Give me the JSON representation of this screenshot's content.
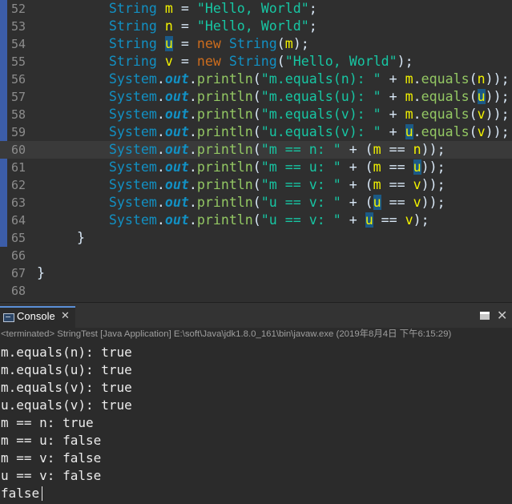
{
  "editor": {
    "current_line": "60",
    "lines": [
      {
        "n": "52",
        "tokens": [
          [
            "         ",
            "p"
          ],
          [
            "String",
            "y"
          ],
          [
            " ",
            "p"
          ],
          [
            "m",
            "v"
          ],
          [
            " = ",
            "p"
          ],
          [
            "\"Hello, World\"",
            "s"
          ],
          [
            ";",
            "p"
          ]
        ]
      },
      {
        "n": "53",
        "tokens": [
          [
            "         ",
            "p"
          ],
          [
            "String",
            "y"
          ],
          [
            " ",
            "p"
          ],
          [
            "n",
            "v"
          ],
          [
            " = ",
            "p"
          ],
          [
            "\"Hello, World\"",
            "s"
          ],
          [
            ";",
            "p"
          ]
        ]
      },
      {
        "n": "54",
        "tokens": [
          [
            "         ",
            "p"
          ],
          [
            "String",
            "y"
          ],
          [
            " ",
            "p"
          ],
          [
            "u",
            "h"
          ],
          [
            " = ",
            "p"
          ],
          [
            "new",
            "k"
          ],
          [
            " ",
            "p"
          ],
          [
            "String",
            "y"
          ],
          [
            "(",
            "p"
          ],
          [
            "m",
            "v"
          ],
          [
            ");",
            "p"
          ]
        ]
      },
      {
        "n": "55",
        "tokens": [
          [
            "         ",
            "p"
          ],
          [
            "String",
            "y"
          ],
          [
            " ",
            "p"
          ],
          [
            "v",
            "v"
          ],
          [
            " = ",
            "p"
          ],
          [
            "new",
            "k"
          ],
          [
            " ",
            "p"
          ],
          [
            "String",
            "y"
          ],
          [
            "(",
            "p"
          ],
          [
            "\"Hello, World\"",
            "s"
          ],
          [
            ");",
            "p"
          ]
        ]
      },
      {
        "n": "56",
        "tokens": [
          [
            "         ",
            "p"
          ],
          [
            "System",
            "y"
          ],
          [
            ".",
            "p"
          ],
          [
            "out",
            "i"
          ],
          [
            ".",
            "p"
          ],
          [
            "println",
            "m"
          ],
          [
            "(",
            "p"
          ],
          [
            "\"m.equals(n): \"",
            "s"
          ],
          [
            " + ",
            "p"
          ],
          [
            "m",
            "v"
          ],
          [
            ".",
            "p"
          ],
          [
            "equals",
            "m"
          ],
          [
            "(",
            "p"
          ],
          [
            "n",
            "v"
          ],
          [
            "));",
            "p"
          ]
        ]
      },
      {
        "n": "57",
        "tokens": [
          [
            "         ",
            "p"
          ],
          [
            "System",
            "y"
          ],
          [
            ".",
            "p"
          ],
          [
            "out",
            "i"
          ],
          [
            ".",
            "p"
          ],
          [
            "println",
            "m"
          ],
          [
            "(",
            "p"
          ],
          [
            "\"m.equals(u): \"",
            "s"
          ],
          [
            " + ",
            "p"
          ],
          [
            "m",
            "v"
          ],
          [
            ".",
            "p"
          ],
          [
            "equals",
            "m"
          ],
          [
            "(",
            "p"
          ],
          [
            "u",
            "h"
          ],
          [
            "));",
            "p"
          ]
        ]
      },
      {
        "n": "58",
        "tokens": [
          [
            "         ",
            "p"
          ],
          [
            "System",
            "y"
          ],
          [
            ".",
            "p"
          ],
          [
            "out",
            "i"
          ],
          [
            ".",
            "p"
          ],
          [
            "println",
            "m"
          ],
          [
            "(",
            "p"
          ],
          [
            "\"m.equals(v): \"",
            "s"
          ],
          [
            " + ",
            "p"
          ],
          [
            "m",
            "v"
          ],
          [
            ".",
            "p"
          ],
          [
            "equals",
            "m"
          ],
          [
            "(",
            "p"
          ],
          [
            "v",
            "v"
          ],
          [
            "));",
            "p"
          ]
        ]
      },
      {
        "n": "59",
        "tokens": [
          [
            "         ",
            "p"
          ],
          [
            "System",
            "y"
          ],
          [
            ".",
            "p"
          ],
          [
            "out",
            "i"
          ],
          [
            ".",
            "p"
          ],
          [
            "println",
            "m"
          ],
          [
            "(",
            "p"
          ],
          [
            "\"u.equals(v): \"",
            "s"
          ],
          [
            " + ",
            "p"
          ],
          [
            "u",
            "h"
          ],
          [
            ".",
            "p"
          ],
          [
            "equals",
            "m"
          ],
          [
            "(",
            "p"
          ],
          [
            "v",
            "v"
          ],
          [
            "));",
            "p"
          ]
        ]
      },
      {
        "n": "60",
        "tokens": [
          [
            "         ",
            "p"
          ],
          [
            "System",
            "y"
          ],
          [
            ".",
            "p"
          ],
          [
            "out",
            "i"
          ],
          [
            ".",
            "p"
          ],
          [
            "println",
            "m"
          ],
          [
            "(",
            "p"
          ],
          [
            "\"m == n: \"",
            "s"
          ],
          [
            " + (",
            "p"
          ],
          [
            "m",
            "v"
          ],
          [
            " == ",
            "p"
          ],
          [
            "n",
            "v"
          ],
          [
            "));",
            "p"
          ]
        ]
      },
      {
        "n": "61",
        "tokens": [
          [
            "         ",
            "p"
          ],
          [
            "System",
            "y"
          ],
          [
            ".",
            "p"
          ],
          [
            "out",
            "i"
          ],
          [
            ".",
            "p"
          ],
          [
            "println",
            "m"
          ],
          [
            "(",
            "p"
          ],
          [
            "\"m == u: \"",
            "s"
          ],
          [
            " + (",
            "p"
          ],
          [
            "m",
            "v"
          ],
          [
            " == ",
            "p"
          ],
          [
            "u",
            "h"
          ],
          [
            "));",
            "p"
          ]
        ]
      },
      {
        "n": "62",
        "tokens": [
          [
            "         ",
            "p"
          ],
          [
            "System",
            "y"
          ],
          [
            ".",
            "p"
          ],
          [
            "out",
            "i"
          ],
          [
            ".",
            "p"
          ],
          [
            "println",
            "m"
          ],
          [
            "(",
            "p"
          ],
          [
            "\"m == v: \"",
            "s"
          ],
          [
            " + (",
            "p"
          ],
          [
            "m",
            "v"
          ],
          [
            " == ",
            "p"
          ],
          [
            "v",
            "v"
          ],
          [
            "));",
            "p"
          ]
        ]
      },
      {
        "n": "63",
        "tokens": [
          [
            "         ",
            "p"
          ],
          [
            "System",
            "y"
          ],
          [
            ".",
            "p"
          ],
          [
            "out",
            "i"
          ],
          [
            ".",
            "p"
          ],
          [
            "println",
            "m"
          ],
          [
            "(",
            "p"
          ],
          [
            "\"u == v: \"",
            "s"
          ],
          [
            " + (",
            "p"
          ],
          [
            "u",
            "h"
          ],
          [
            " == ",
            "p"
          ],
          [
            "v",
            "v"
          ],
          [
            "));",
            "p"
          ]
        ]
      },
      {
        "n": "64",
        "tokens": [
          [
            "         ",
            "p"
          ],
          [
            "System",
            "y"
          ],
          [
            ".",
            "p"
          ],
          [
            "out",
            "i"
          ],
          [
            ".",
            "p"
          ],
          [
            "println",
            "m"
          ],
          [
            "(",
            "p"
          ],
          [
            "\"u == v: \"",
            "s"
          ],
          [
            " + ",
            "p"
          ],
          [
            "u",
            "h"
          ],
          [
            " == ",
            "p"
          ],
          [
            "v",
            "v"
          ],
          [
            ");",
            "p"
          ]
        ]
      },
      {
        "n": "65",
        "tokens": [
          [
            "     }",
            "p"
          ]
        ]
      },
      {
        "n": "66",
        "tokens": []
      },
      {
        "n": "67",
        "tokens": [
          [
            "}",
            "p"
          ]
        ]
      },
      {
        "n": "68",
        "tokens": []
      }
    ]
  },
  "console": {
    "tab_label": "Console",
    "close_glyph": "✕",
    "maximize_icon": "maximize-icon",
    "view_close_glyph": "✕",
    "status": "<terminated> StringTest [Java Application] E:\\soft\\Java\\jdk1.8.0_161\\bin\\javaw.exe (2019年8月4日 下午6:15:29)",
    "output": [
      "m.equals(n): true",
      "m.equals(u): true",
      "m.equals(v): true",
      "u.equals(v): true",
      "m == n: true",
      "m == u: false",
      "m == v: false",
      "u == v: false",
      "false"
    ]
  }
}
